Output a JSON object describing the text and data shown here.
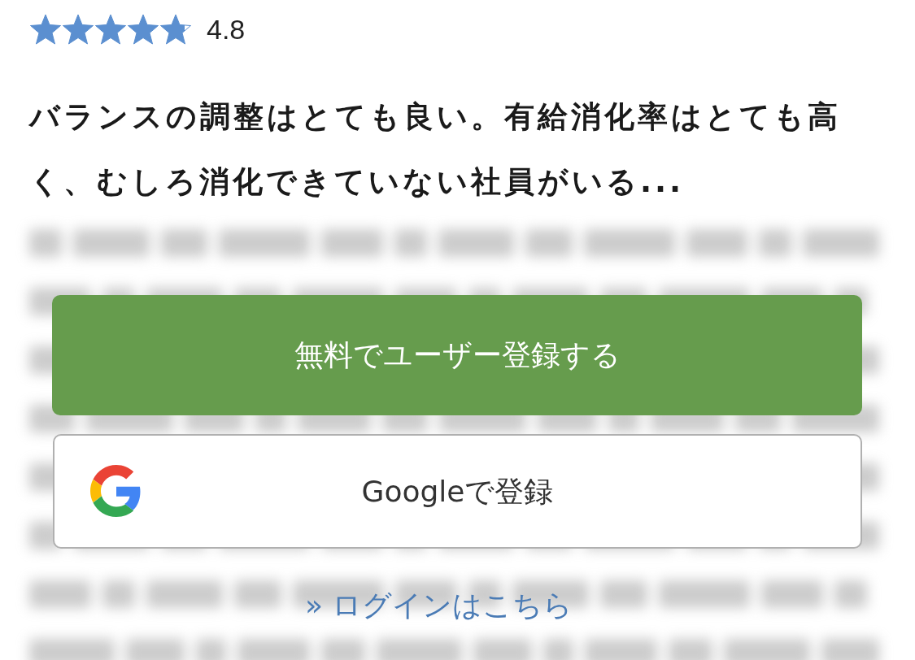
{
  "rating": {
    "stars": 4.8,
    "score": "4.8"
  },
  "review": {
    "text": "バランスの調整はとても良い。有給消化率はとても高く、むしろ消化できていない社員がいる..."
  },
  "signup_button": {
    "label": "無料でユーザー登録する"
  },
  "google_button": {
    "label": "Googleで登録"
  },
  "login_link": {
    "prefix": "»",
    "label": "ログインはこちら"
  }
}
